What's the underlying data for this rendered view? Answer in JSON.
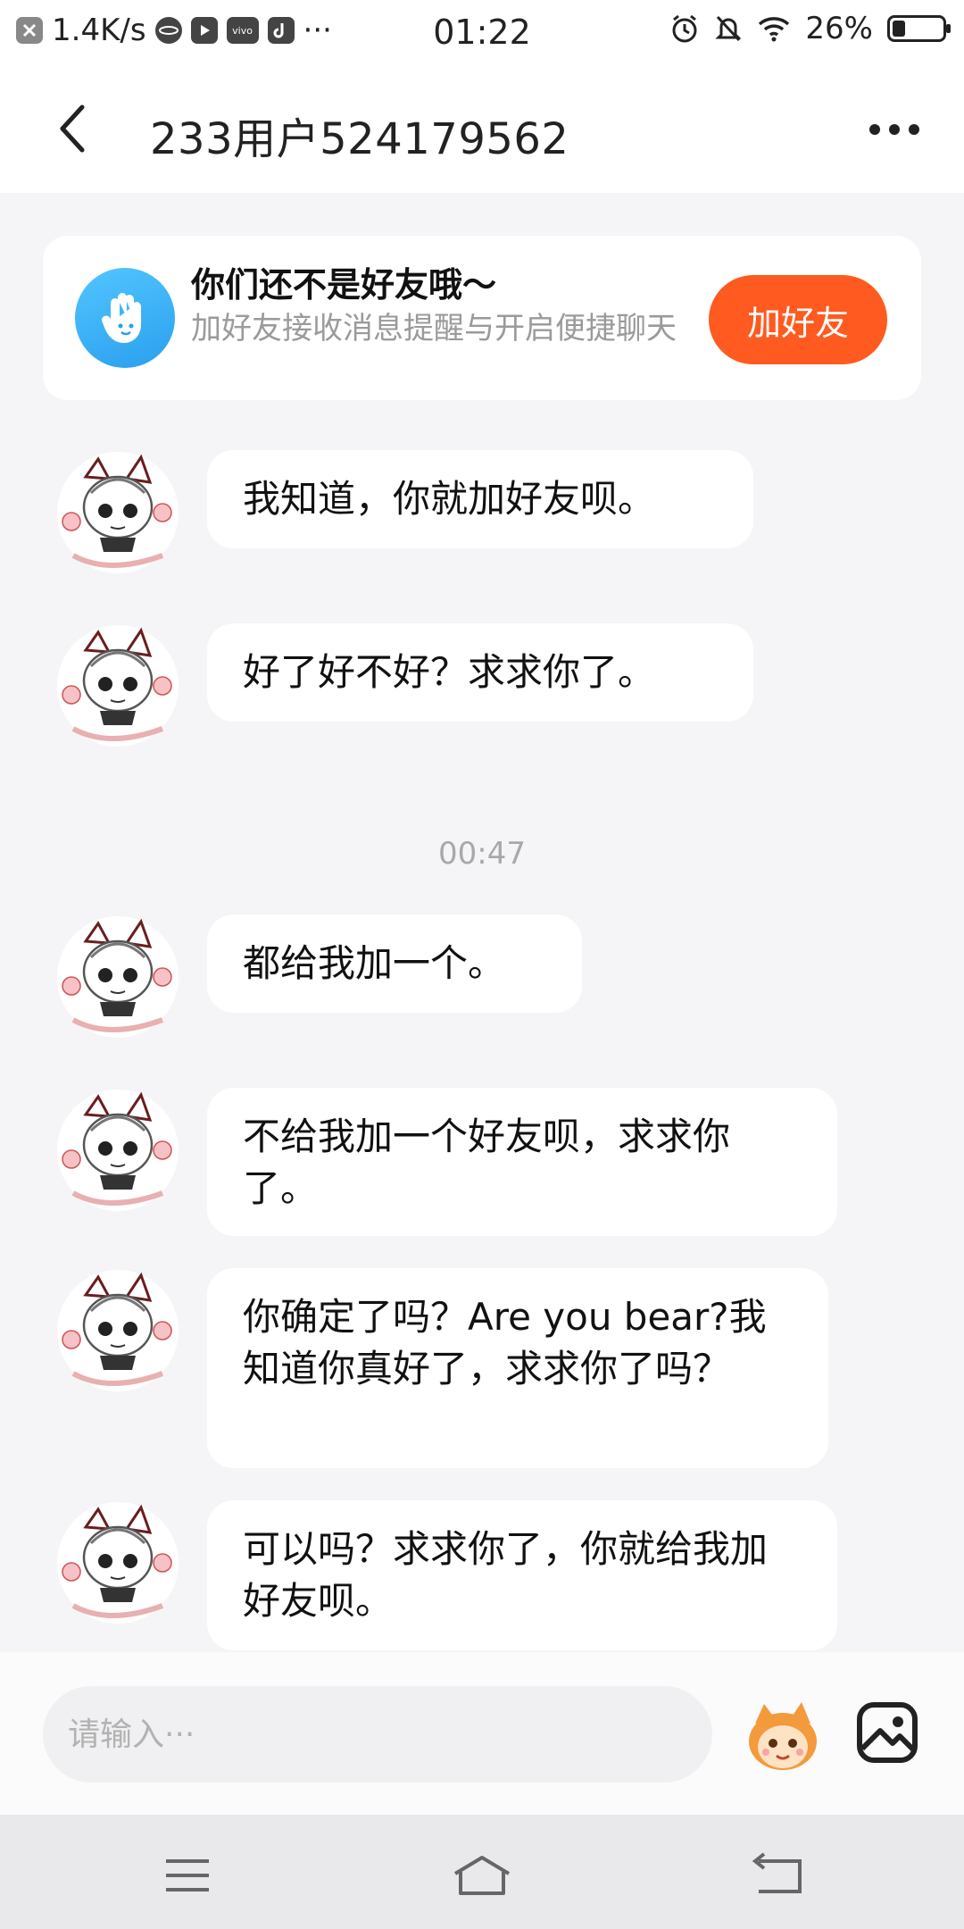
{
  "status_bar": {
    "net_speed": "1.4K/s",
    "time": "01:22",
    "battery_percent_text": "26%",
    "battery_level": 0.26,
    "app_icons": [
      "close-app-icon",
      "planet-app-icon",
      "video-app-icon",
      "vivo-app-icon",
      "tiktok-app-icon"
    ],
    "more_label": "···"
  },
  "header": {
    "title": "233用户524179562"
  },
  "banner": {
    "title": "你们还不是好友哦～",
    "subtitle": "加好友接收消息提醒与开启便捷聊天",
    "button_label": "加好友"
  },
  "messages": [
    {
      "text": "我知道，你就加好友呗。"
    },
    {
      "text": "好了好不好？求求你了。"
    },
    {
      "text": "都给我加一个。"
    },
    {
      "text": "不给我加一个好友呗，求求你了。"
    },
    {
      "text": "你确定了吗？Are you bear?我知道你真好了，求求你了吗？"
    },
    {
      "text": "可以吗？求求你了，你就给我加好友呗。"
    }
  ],
  "timestamp": "00:47",
  "input": {
    "placeholder": "请输入···"
  },
  "colors": {
    "accent": "#ff5a1f",
    "background": "#f5f5f7",
    "bubble": "#ffffff",
    "banner_icon": "#3aaff5"
  }
}
